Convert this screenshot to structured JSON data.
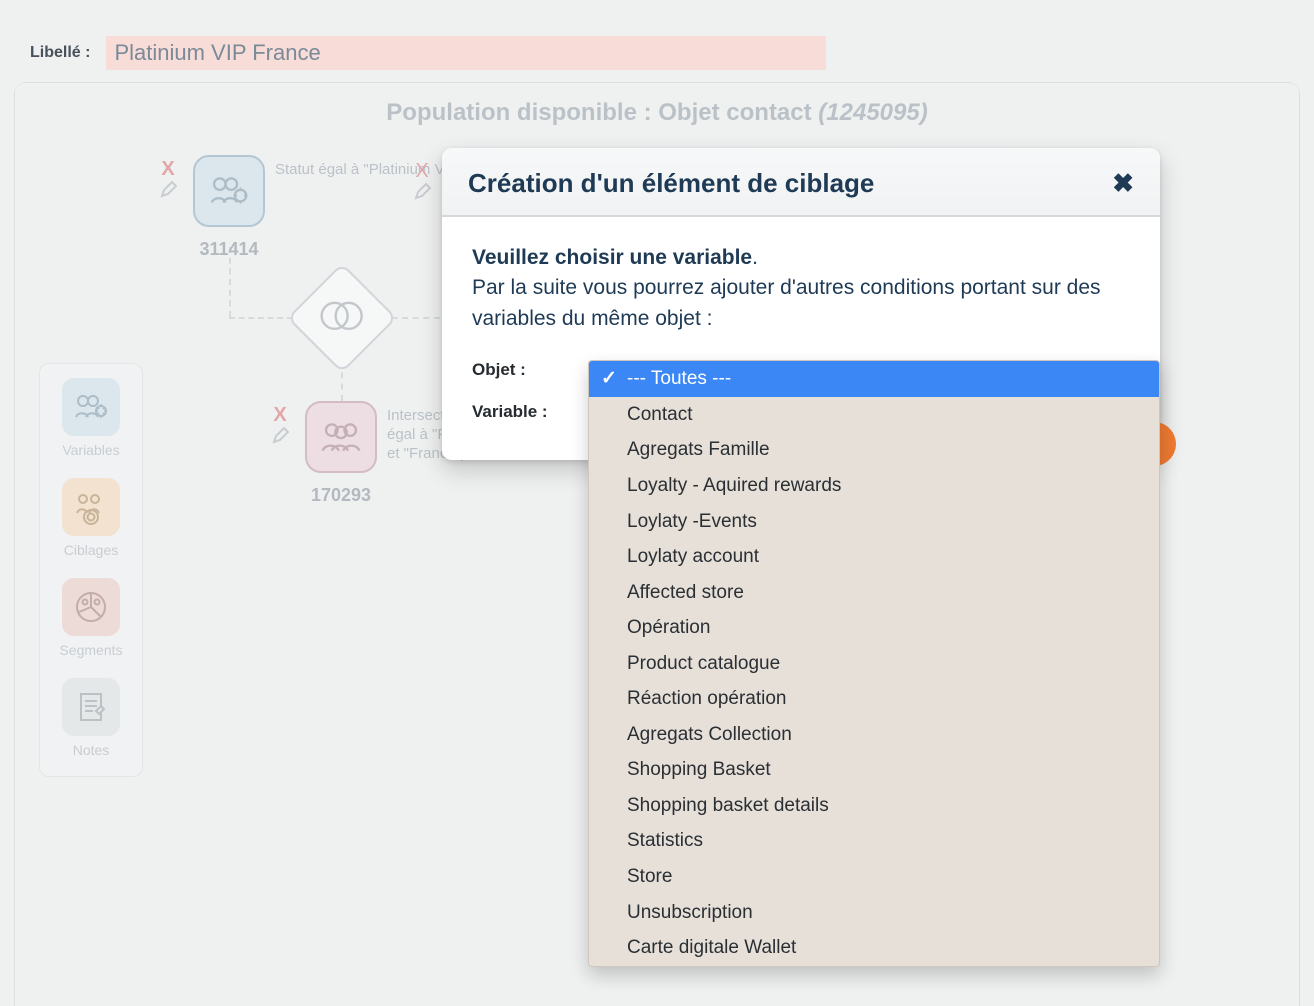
{
  "header": {
    "libelle_label": "Libellé :",
    "libelle_value": "Platinium VIP France"
  },
  "population": {
    "prefix": "Population disponible : ",
    "object": "Objet contact",
    "count": "(1245095)"
  },
  "toolbox": {
    "items": [
      {
        "id": "variables",
        "label": "Variables",
        "color": "blue",
        "icon": "users-gear"
      },
      {
        "id": "ciblages",
        "label": "Ciblages",
        "color": "orange",
        "icon": "target-users"
      },
      {
        "id": "segments",
        "label": "Segments",
        "color": "salmon",
        "icon": "pie-users"
      },
      {
        "id": "notes",
        "label": "Notes",
        "color": "grey",
        "icon": "note"
      }
    ]
  },
  "nodes": {
    "a": {
      "count": "311414",
      "desc": "Statut égal à \"Platinium VIP\""
    },
    "b": {
      "count": "170293",
      "desc": "Intersection (Statut égal à \"Platinium VIP\" et \"France\")"
    }
  },
  "modal": {
    "title": "Création d'un élément de ciblage",
    "lead_strong": "Veuillez choisir une variable",
    "lead_rest": "Par la suite vous pourrez ajouter d'autres conditions portant sur des variables du même objet :",
    "label_objet": "Objet :",
    "label_variable": "Variable :",
    "dropdown": {
      "selected_index": 0,
      "options": [
        "--- Toutes ---",
        "Contact",
        "Agregats Famille",
        "Loyalty - Aquired rewards",
        "Loylaty -Events",
        "Loylaty account",
        "Affected store",
        "Opération",
        "Product catalogue",
        "Réaction opération",
        "Agregats Collection",
        "Shopping Basket",
        "Shopping basket details",
        "Statistics",
        "Store",
        "Unsubscription",
        "Carte digitale Wallet"
      ]
    }
  }
}
